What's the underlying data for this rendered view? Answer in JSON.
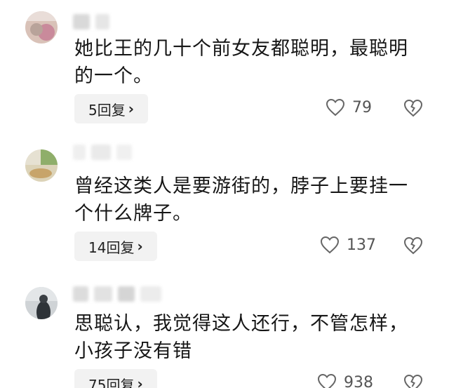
{
  "comments": [
    {
      "username": "",
      "text": "她比王的几十个前女友都聪明，最聪明的一个。",
      "reply_label": "5回复",
      "like_count": "79"
    },
    {
      "username": "",
      "text": "曾经这类人是要游街的，脖子上要挂一个什么牌子。",
      "reply_label": "14回复",
      "like_count": "137"
    },
    {
      "username": "",
      "text": "思聪认，我觉得这人还行，不管怎样，小孩子没有错",
      "reply_label": "75回复",
      "like_count": "938"
    }
  ],
  "icons": {
    "reply_chevron": "chevron-right-icon",
    "like": "heart-outline-icon",
    "dislike": "broken-heart-outline-icon"
  }
}
